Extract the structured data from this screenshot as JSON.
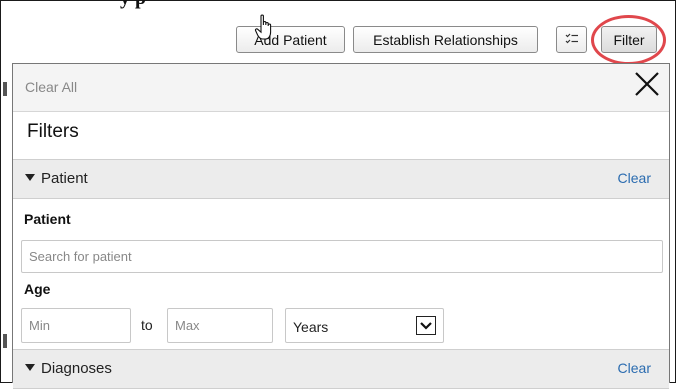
{
  "header_fragment": "y p",
  "toolbar": {
    "add_patient_label": "Add Patient",
    "establish_relationships_label": "Establish Relationships",
    "list_icon": "checklist-icon",
    "filter_label": "Filter"
  },
  "panel": {
    "clear_all_label": "Clear All",
    "close_icon": "close-icon",
    "title": "Filters",
    "patient_section": {
      "label": "Patient",
      "clear_label": "Clear",
      "patient_field_label": "Patient",
      "search_placeholder": "Search for patient",
      "age_label": "Age",
      "min_placeholder": "Min",
      "to_label": "to",
      "max_placeholder": "Max",
      "unit_value": "Years",
      "unit_options": [
        "Years"
      ]
    },
    "diagnoses_section": {
      "label": "Diagnoses",
      "clear_label": "Clear"
    }
  },
  "colors": {
    "highlight_ring": "#e0474c",
    "link": "#2b6cb0",
    "section_bg": "#ececec"
  }
}
